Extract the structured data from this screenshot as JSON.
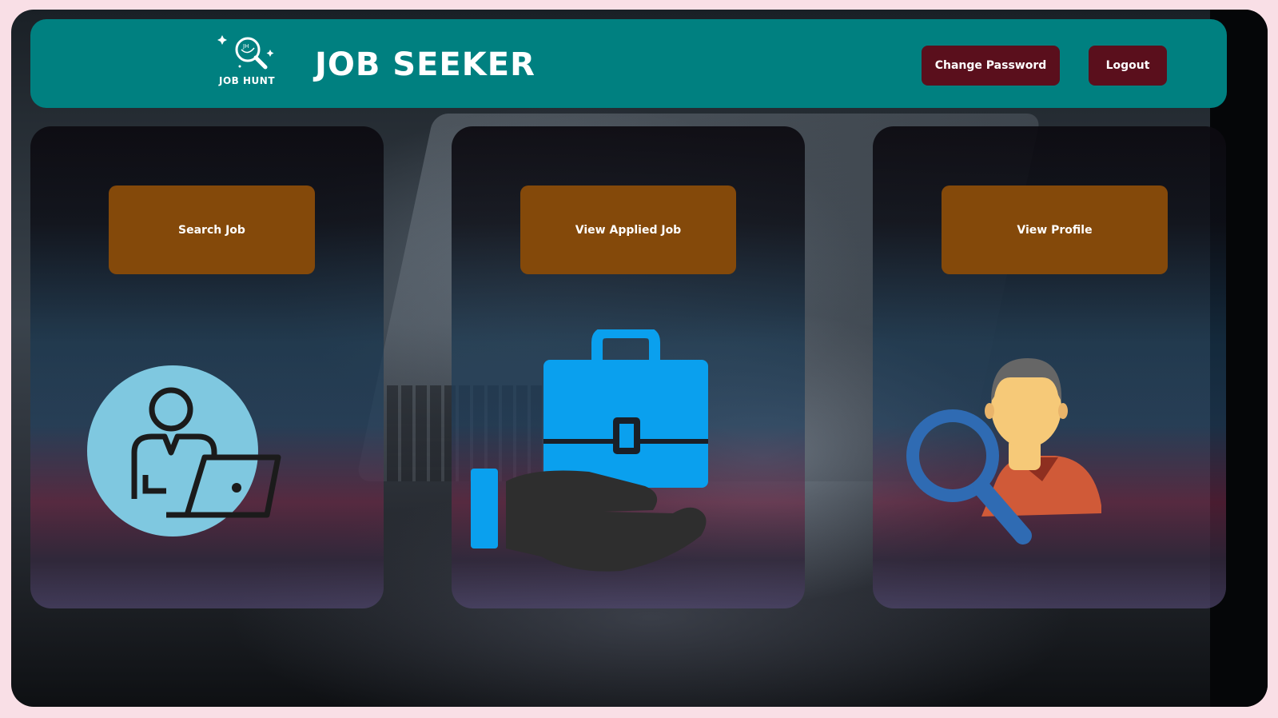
{
  "header": {
    "logo_text": "JOB HUNT",
    "title": "JOB SEEKER",
    "change_password_label": "Change Password",
    "logout_label": "Logout",
    "background_color": "#008080",
    "button_color": "#5a0f1c"
  },
  "cards": [
    {
      "button_label": "Search Job",
      "icon": "person-laptop-icon"
    },
    {
      "button_label": "View Applied Job",
      "icon": "briefcase-hand-icon"
    },
    {
      "button_label": "View Profile",
      "icon": "profile-search-icon"
    }
  ],
  "colors": {
    "card_button": "#84490a",
    "page_border": "#f9dfe6"
  }
}
